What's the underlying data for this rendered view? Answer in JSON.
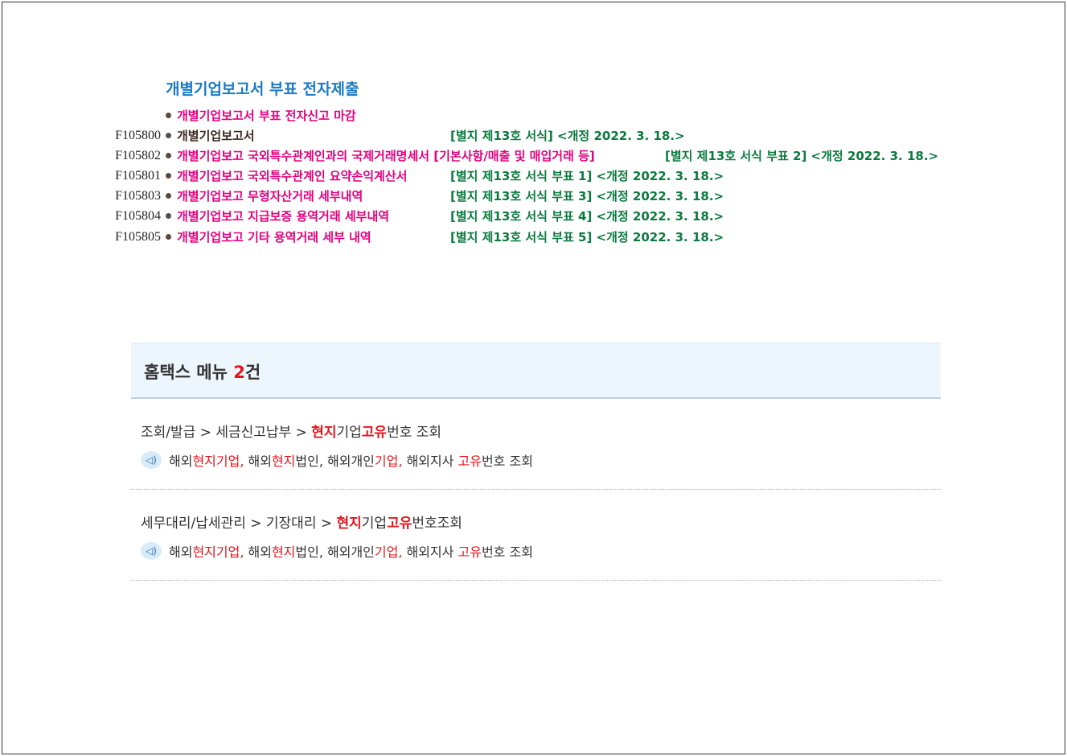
{
  "section": {
    "title": "개별기업보고서 부표 전자제출",
    "deadline_label": "개별기업보고서 부표 전자신고 마감",
    "forms": [
      {
        "code": "F105800",
        "label": "개별기업보고서",
        "ref": "[별지 제13호 서식] <개정 2022. 3. 18.>"
      },
      {
        "code": "F105802",
        "label": "개별기업보고 국외특수관계인과의 국제거래명세서 [기본사항/매출 및 매입거래 등]",
        "ref": "[별지 제13호 서식 부표 2] <개정 2022. 3. 18.>"
      },
      {
        "code": "F105801",
        "label": "개별기업보고 국외특수관계인 요약손익계산서",
        "ref": "[별지 제13호 서식 부표 1] <개정 2022. 3. 18.>"
      },
      {
        "code": "F105803",
        "label": "개별기업보고 무형자산거래 세부내역",
        "ref": "[별지 제13호 서식 부표 3] <개정 2022. 3. 18.>"
      },
      {
        "code": "F105804",
        "label": "개별기업보고 지급보증 용역거래 세부내역",
        "ref": "[별지 제13호 서식 부표 4] <개정 2022. 3. 18.>"
      },
      {
        "code": "F105805",
        "label": "개별기업보고 기타 용역거래 세부 내역",
        "ref": "[별지 제13호 서식 부표 5] <개정 2022. 3. 18.>"
      }
    ]
  },
  "menu": {
    "title": "홈택스 메뉴 ",
    "count": "2",
    "count_suffix": "건",
    "results": [
      {
        "path": [
          {
            "t": "조회/발급 > 세금신고납부 > ",
            "h": false
          },
          {
            "t": "현지",
            "h": true
          },
          {
            "t": "기업",
            "h": false
          },
          {
            "t": "고유",
            "h": true
          },
          {
            "t": "번호 조회",
            "h": false
          }
        ],
        "desc": [
          {
            "t": "해외",
            "h": false
          },
          {
            "t": "현지기업,",
            "h": true
          },
          {
            "t": " 해외",
            "h": false
          },
          {
            "t": "현지",
            "h": true
          },
          {
            "t": "법인, 해외개인",
            "h": false
          },
          {
            "t": "기업,",
            "h": true
          },
          {
            "t": " 해외지사 ",
            "h": false
          },
          {
            "t": "고유",
            "h": true
          },
          {
            "t": "번호 조회",
            "h": false
          }
        ]
      },
      {
        "path": [
          {
            "t": "세무대리/납세관리 > 기장대리 > ",
            "h": false
          },
          {
            "t": "현지",
            "h": true
          },
          {
            "t": "기업",
            "h": false
          },
          {
            "t": "고유",
            "h": true
          },
          {
            "t": "번호조회",
            "h": false
          }
        ],
        "desc": [
          {
            "t": "해외",
            "h": false
          },
          {
            "t": "현지기업,",
            "h": true
          },
          {
            "t": " 해외",
            "h": false
          },
          {
            "t": "현지",
            "h": true
          },
          {
            "t": "법인, 해외개인",
            "h": false
          },
          {
            "t": "기업,",
            "h": true
          },
          {
            "t": " 해외지사 ",
            "h": false
          },
          {
            "t": "고유",
            "h": true
          },
          {
            "t": "번호 조회",
            "h": false
          }
        ]
      }
    ]
  }
}
